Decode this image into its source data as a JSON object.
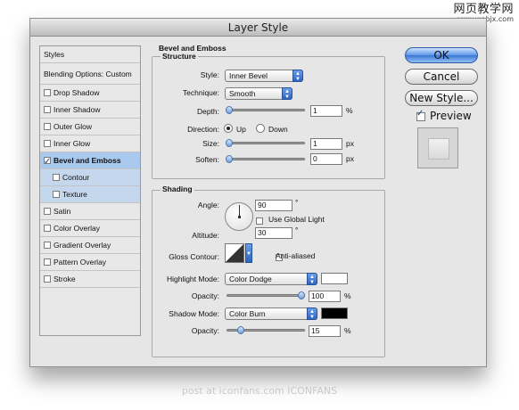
{
  "watermark": {
    "line1": "网页教学网",
    "line2": "www.webjx.com"
  },
  "footer": {
    "text": "post at iconfans.com ICONFANS"
  },
  "window": {
    "title": "Layer Style"
  },
  "styles_list": {
    "header": "Styles",
    "blending_options": "Blending Options: Custom",
    "items": [
      {
        "label": "Drop Shadow",
        "checked": false
      },
      {
        "label": "Inner Shadow",
        "checked": false
      },
      {
        "label": "Outer Glow",
        "checked": false
      },
      {
        "label": "Inner Glow",
        "checked": false
      },
      {
        "label": "Bevel and Emboss",
        "checked": true
      },
      {
        "label": "Contour",
        "checked": false
      },
      {
        "label": "Texture",
        "checked": false
      },
      {
        "label": "Satin",
        "checked": false
      },
      {
        "label": "Color Overlay",
        "checked": false
      },
      {
        "label": "Gradient Overlay",
        "checked": false
      },
      {
        "label": "Pattern Overlay",
        "checked": false
      },
      {
        "label": "Stroke",
        "checked": false
      }
    ]
  },
  "bevel": {
    "section_title": "Bevel and Emboss",
    "structure": {
      "title": "Structure",
      "style_label": "Style:",
      "style_value": "Inner Bevel",
      "technique_label": "Technique:",
      "technique_value": "Smooth",
      "depth_label": "Depth:",
      "depth_value": "1",
      "depth_unit": "%",
      "direction_label": "Direction:",
      "direction_up": "Up",
      "direction_down": "Down",
      "size_label": "Size:",
      "size_value": "1",
      "size_unit": "px",
      "soften_label": "Soften:",
      "soften_value": "0",
      "soften_unit": "px"
    },
    "shading": {
      "title": "Shading",
      "angle_label": "Angle:",
      "angle_value": "90",
      "angle_unit": "°",
      "use_global_light": "Use Global Light",
      "altitude_label": "Altitude:",
      "altitude_value": "30",
      "altitude_unit": "°",
      "gloss_contour_label": "Gloss Contour:",
      "anti_aliased": "Anti-aliased",
      "highlight_mode_label": "Highlight Mode:",
      "highlight_mode_value": "Color Dodge",
      "highlight_color": "#ffffff",
      "highlight_opacity_label": "Opacity:",
      "highlight_opacity_value": "100",
      "highlight_opacity_unit": "%",
      "shadow_mode_label": "Shadow Mode:",
      "shadow_mode_value": "Color Burn",
      "shadow_color": "#000000",
      "shadow_opacity_label": "Opacity:",
      "shadow_opacity_value": "15",
      "shadow_opacity_unit": "%"
    }
  },
  "buttons": {
    "ok": "OK",
    "cancel": "Cancel",
    "new_style": "New Style..."
  },
  "preview": {
    "label": "Preview",
    "checked": true
  }
}
